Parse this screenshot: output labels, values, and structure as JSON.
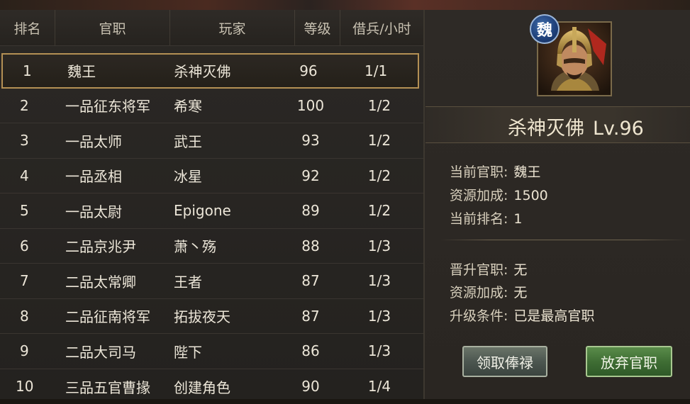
{
  "table": {
    "headers": {
      "rank": "排名",
      "title": "官职",
      "player": "玩家",
      "level": "等级",
      "borrow": "借兵/小时"
    },
    "rows": [
      {
        "rank": "1",
        "title": "魏王",
        "player": "杀神灭佛",
        "level": "96",
        "borrow": "1/1"
      },
      {
        "rank": "2",
        "title": "一品征东将军",
        "player": "希寒",
        "level": "100",
        "borrow": "1/2"
      },
      {
        "rank": "3",
        "title": "一品太师",
        "player": "武王",
        "level": "93",
        "borrow": "1/2"
      },
      {
        "rank": "4",
        "title": "一品丞相",
        "player": "冰星",
        "level": "92",
        "borrow": "1/2"
      },
      {
        "rank": "5",
        "title": "一品太尉",
        "player": "Epigone",
        "level": "89",
        "borrow": "1/2"
      },
      {
        "rank": "6",
        "title": "二品京兆尹",
        "player": "萧丶殇",
        "level": "88",
        "borrow": "1/3"
      },
      {
        "rank": "7",
        "title": "二品太常卿",
        "player": "王者",
        "level": "87",
        "borrow": "1/3"
      },
      {
        "rank": "8",
        "title": "二品征南将军",
        "player": "拓拔夜天",
        "level": "87",
        "borrow": "1/3"
      },
      {
        "rank": "9",
        "title": "二品大司马",
        "player": "陛下",
        "level": "86",
        "borrow": "1/3"
      },
      {
        "rank": "10",
        "title": "三品五官曹掾",
        "player": "创建角色",
        "level": "90",
        "borrow": "1/4"
      }
    ],
    "selected_row": 0
  },
  "profile": {
    "kingdom": "魏",
    "name": "杀神灭佛",
    "level": "Lv.96",
    "current_title_label": "当前官职:",
    "current_title": "魏王",
    "resource_bonus_label": "资源加成:",
    "resource_bonus": "1500",
    "current_rank_label": "当前排名:",
    "current_rank": "1",
    "promote_title_label": "晋升官职:",
    "promote_title": "无",
    "promote_bonus_label": "资源加成:",
    "promote_bonus": "无",
    "upgrade_cond_label": "升级条件:",
    "upgrade_cond": "已是最高官职"
  },
  "buttons": {
    "collect_salary": "领取俸禄",
    "abandon_title": "放弃官职"
  },
  "colors": {
    "selected_border": "#b49054",
    "kingdom_badge": "#1e3f78",
    "abandon_button": "#3f6e34"
  }
}
